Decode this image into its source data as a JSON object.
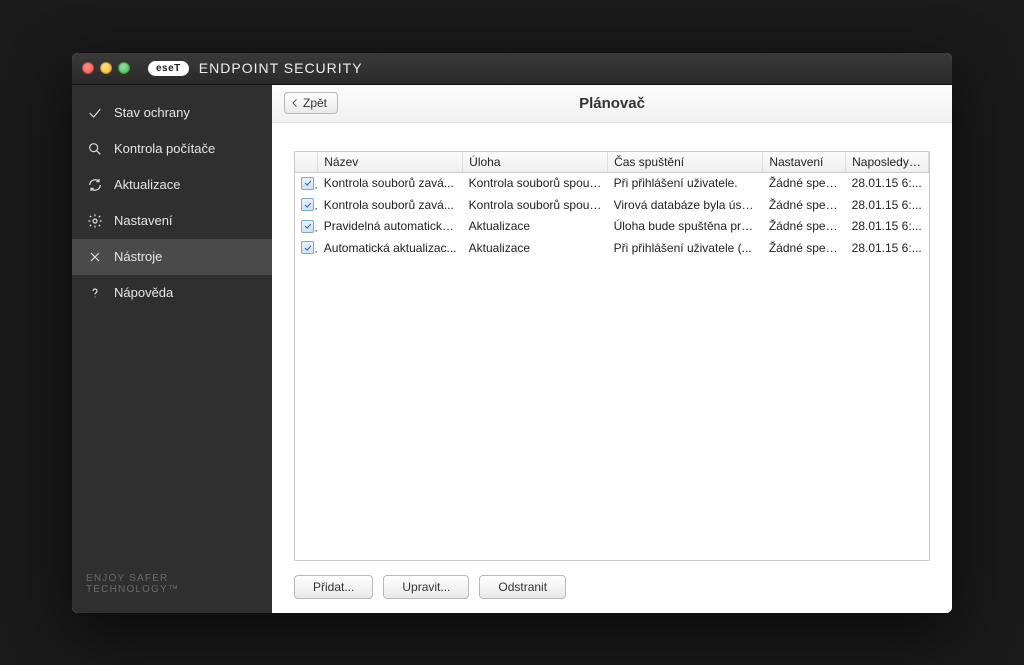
{
  "brand": {
    "logo": "eseT",
    "title": "ENDPOINT SECURITY"
  },
  "sidebar": {
    "items": [
      {
        "label": "Stav ochrany"
      },
      {
        "label": "Kontrola počítače"
      },
      {
        "label": "Aktualizace"
      },
      {
        "label": "Nastavení"
      },
      {
        "label": "Nástroje"
      },
      {
        "label": "Nápověda"
      }
    ],
    "footer": "ENJOY SAFER TECHNOLOGY™"
  },
  "header": {
    "back": "Zpět",
    "title": "Plánovač"
  },
  "table": {
    "columns": [
      "Název",
      "Úloha",
      "Čas spuštění",
      "Nastavení",
      "Naposledy s..."
    ],
    "rows": [
      {
        "name": "Kontrola souborů zavá...",
        "task": "Kontrola souborů spouš...",
        "time": "Při přihlášení uživatele.",
        "settings": "Žádné speci...",
        "last": "28.01.15 6:..."
      },
      {
        "name": "Kontrola souborů zavá...",
        "task": "Kontrola souborů spouš...",
        "time": "Virová databáze byla úsp...",
        "settings": "Žádné speci...",
        "last": "28.01.15 6:..."
      },
      {
        "name": "Pravidelná automatická...",
        "task": "Aktualizace",
        "time": "Úloha bude spuštěna pra...",
        "settings": "Žádné speci...",
        "last": "28.01.15 6:..."
      },
      {
        "name": "Automatická aktualizac...",
        "task": "Aktualizace",
        "time": "Při přihlášení uživatele (...",
        "settings": "Žádné speci...",
        "last": "28.01.15 6:..."
      }
    ]
  },
  "buttons": {
    "add": "Přidat...",
    "edit": "Upravit...",
    "remove": "Odstranit"
  }
}
